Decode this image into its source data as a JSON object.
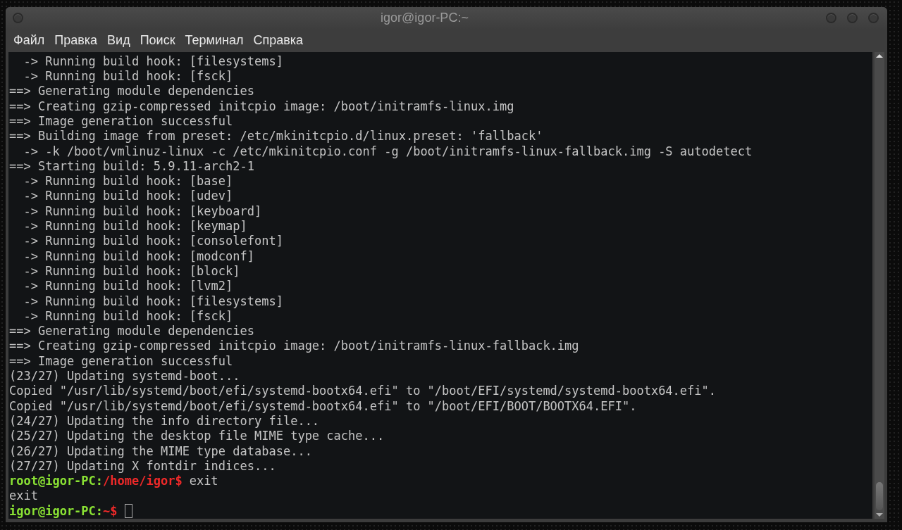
{
  "window": {
    "title": "igor@igor-PC:~"
  },
  "menu": [
    "Файл",
    "Правка",
    "Вид",
    "Поиск",
    "Терминал",
    "Справка"
  ],
  "lines": [
    {
      "kind": "output",
      "text": "  -> Running build hook: [filesystems]"
    },
    {
      "kind": "output",
      "text": "  -> Running build hook: [fsck]"
    },
    {
      "kind": "output",
      "text": "==> Generating module dependencies"
    },
    {
      "kind": "output",
      "text": "==> Creating gzip-compressed initcpio image: /boot/initramfs-linux.img"
    },
    {
      "kind": "output",
      "text": "==> Image generation successful"
    },
    {
      "kind": "output",
      "text": "==> Building image from preset: /etc/mkinitcpio.d/linux.preset: 'fallback'"
    },
    {
      "kind": "output",
      "text": "  -> -k /boot/vmlinuz-linux -c /etc/mkinitcpio.conf -g /boot/initramfs-linux-fallback.img -S autodetect"
    },
    {
      "kind": "output",
      "text": "==> Starting build: 5.9.11-arch2-1"
    },
    {
      "kind": "output",
      "text": "  -> Running build hook: [base]"
    },
    {
      "kind": "output",
      "text": "  -> Running build hook: [udev]"
    },
    {
      "kind": "output",
      "text": "  -> Running build hook: [keyboard]"
    },
    {
      "kind": "output",
      "text": "  -> Running build hook: [keymap]"
    },
    {
      "kind": "output",
      "text": "  -> Running build hook: [consolefont]"
    },
    {
      "kind": "output",
      "text": "  -> Running build hook: [modconf]"
    },
    {
      "kind": "output",
      "text": "  -> Running build hook: [block]"
    },
    {
      "kind": "output",
      "text": "  -> Running build hook: [lvm2]"
    },
    {
      "kind": "output",
      "text": "  -> Running build hook: [filesystems]"
    },
    {
      "kind": "output",
      "text": "  -> Running build hook: [fsck]"
    },
    {
      "kind": "output",
      "text": "==> Generating module dependencies"
    },
    {
      "kind": "output",
      "text": "==> Creating gzip-compressed initcpio image: /boot/initramfs-linux-fallback.img"
    },
    {
      "kind": "output",
      "text": "==> Image generation successful"
    },
    {
      "kind": "output",
      "text": "(23/27) Updating systemd-boot..."
    },
    {
      "kind": "output",
      "text": "Copied \"/usr/lib/systemd/boot/efi/systemd-bootx64.efi\" to \"/boot/EFI/systemd/systemd-bootx64.efi\"."
    },
    {
      "kind": "output",
      "text": "Copied \"/usr/lib/systemd/boot/efi/systemd-bootx64.efi\" to \"/boot/EFI/BOOT/BOOTX64.EFI\"."
    },
    {
      "kind": "output",
      "text": "(24/27) Updating the info directory file..."
    },
    {
      "kind": "output",
      "text": "(25/27) Updating the desktop file MIME type cache..."
    },
    {
      "kind": "output",
      "text": "(26/27) Updating the MIME type database..."
    },
    {
      "kind": "output",
      "text": "(27/27) Updating X fontdir indices..."
    },
    {
      "kind": "prompt",
      "host": "root@igor-PC:",
      "path": "/home/igor$",
      "command": "exit",
      "cursor": false
    },
    {
      "kind": "output",
      "text": "exit"
    },
    {
      "kind": "prompt",
      "host": "igor@igor-PC:",
      "path": "~$",
      "cursor": true
    }
  ]
}
